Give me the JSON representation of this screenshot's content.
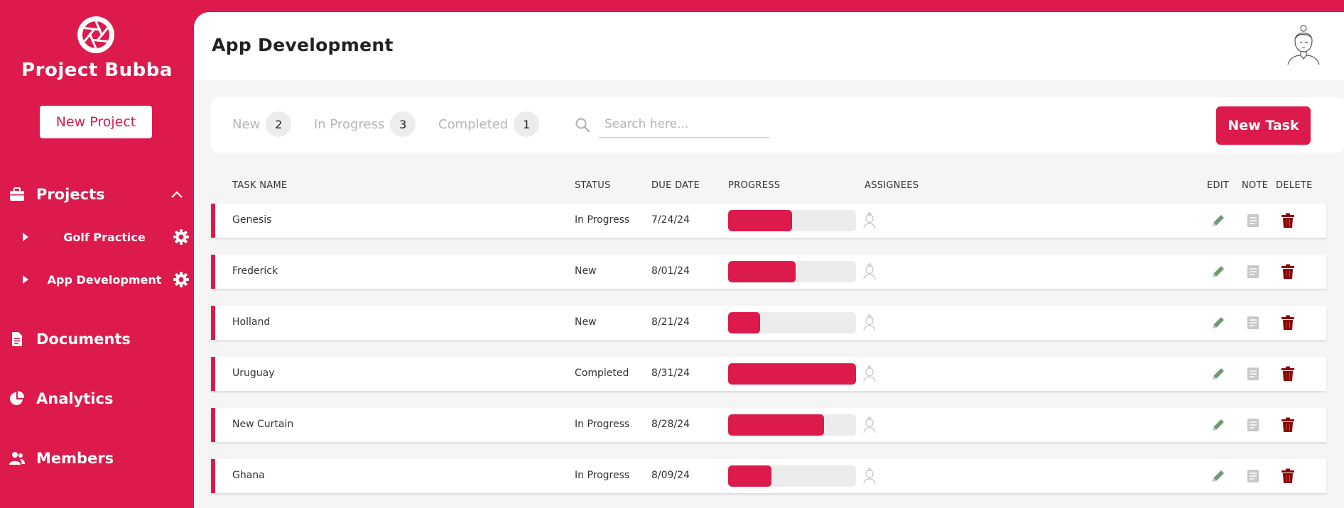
{
  "sidebar": {
    "brand": "Project Bubba",
    "new_project_label": "New Project",
    "nav": {
      "projects": "Projects",
      "documents": "Documents",
      "analytics": "Analytics",
      "members": "Members"
    },
    "projects": [
      "Golf Practice",
      "App Development"
    ]
  },
  "header": {
    "title": "App Development"
  },
  "toolbar": {
    "tabs": [
      {
        "label": "New",
        "count": "2"
      },
      {
        "label": "In Progress",
        "count": "3"
      },
      {
        "label": "Completed",
        "count": "1"
      }
    ],
    "search_placeholder": "Search here...",
    "new_task_label": "New Task"
  },
  "table": {
    "headers": {
      "name": "TASK NAME",
      "status": "STATUS",
      "due": "DUE DATE",
      "progress": "PROGRESS",
      "assignees": "ASSIGNEES",
      "edit": "EDIT",
      "note": "NOTE",
      "delete": "DELETE"
    },
    "rows": [
      {
        "name": "Genesis",
        "status": "In Progress",
        "due": "7/24/24",
        "progress": 50
      },
      {
        "name": "Frederick",
        "status": "New",
        "due": "8/01/24",
        "progress": 53
      },
      {
        "name": "Holland",
        "status": "New",
        "due": "8/21/24",
        "progress": 25
      },
      {
        "name": "Uruguay",
        "status": "Completed",
        "due": "8/31/24",
        "progress": 100
      },
      {
        "name": "New Curtain",
        "status": "In Progress",
        "due": "8/28/24",
        "progress": 75
      },
      {
        "name": "Ghana",
        "status": "In Progress",
        "due": "8/09/24",
        "progress": 34
      }
    ]
  },
  "colors": {
    "accent": "#dc1a4b",
    "edit_icon": "#6f9a6f",
    "note_icon": "#c8c8c8",
    "delete_icon": "#8b0000"
  },
  "icons": {
    "logo": "aperture-icon",
    "projects": "briefcase-icon",
    "documents": "document-icon",
    "analytics": "pie-chart-icon",
    "members": "users-icon",
    "edit": "pencil-icon",
    "note": "note-icon",
    "delete": "trash-icon"
  }
}
